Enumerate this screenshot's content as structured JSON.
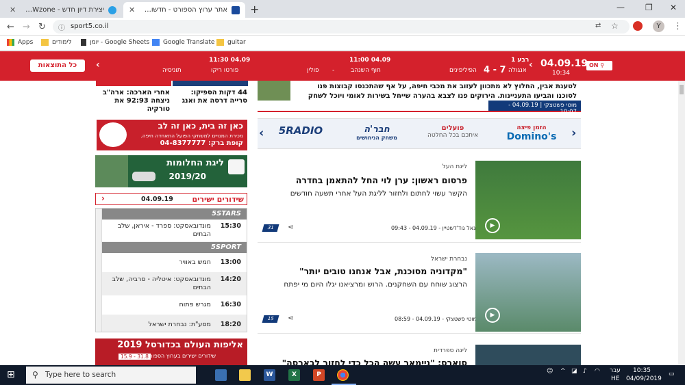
{
  "browser": {
    "tabs": [
      {
        "title": "יצירת דיון חדש - HWzone פורומים"
      },
      {
        "title": "אתר ערוץ הספורט - חדשות הספורט"
      }
    ],
    "new_tab": "+",
    "url": "sport5.co.il",
    "avatar_letter": "Y"
  },
  "bookmarks": [
    {
      "label": "Apps"
    },
    {
      "label": "לימודים"
    },
    {
      "label": "יומן - Google Sheets"
    },
    {
      "label": "Google Translate"
    },
    {
      "label": "guitar"
    }
  ],
  "scoreboard": {
    "results_button": "כל התוצאות",
    "date": "04.09.19",
    "clock": "10:34",
    "toggle": "ON",
    "games": [
      {
        "time": "רבע 1",
        "home": "אנגולה",
        "away": "הפיליפינים",
        "score": "7 - 4"
      },
      {
        "time": "04.09 11:00",
        "home": "חוף השנהב",
        "away": "פולין",
        "score": "-"
      },
      {
        "time": "04.09 11:30",
        "home": "פורטו ריקו",
        "away": "תוניסיה",
        "score": "-"
      }
    ]
  },
  "sidebar": {
    "news": [
      {
        "title": "44 דקות הספיקו: סרייה דרסה את ואנג"
      },
      {
        "title": "אחרי הארכה: ארה\"ב ניצחה 92:93 את טורקיה"
      }
    ],
    "ad_hapoel": {
      "headline": "כאן זה בית, כאן זה לב",
      "sub": "מכירת המנויים למשחקי הפועל התאחדה חיפה.",
      "phone": "קופת ברק: 04-8377777"
    },
    "ad_league": {
      "title": "ליגת החלומות",
      "season": "2019/20"
    },
    "live": {
      "title": "שידורים ישירים",
      "date": "04.09.19",
      "channels": [
        {
          "name": "5STARS",
          "rows": [
            {
              "time": "15:30",
              "name": "מונדובאסקט: ספרד - איראן, שלב הבתים"
            }
          ]
        },
        {
          "name": "5SPORT",
          "rows": [
            {
              "time": "13:00",
              "name": "חמש באוויר"
            },
            {
              "time": "14:20",
              "name": "מונדובאסקט: איטליה - סרביה, שלב הבתים"
            },
            {
              "time": "16:30",
              "name": "מגרש פתוח"
            },
            {
              "time": "18:20",
              "name": "מסע\"ת: נבחרת ישראל"
            }
          ]
        }
      ]
    },
    "ad_worldcup": {
      "title": "אליפות העולם בכדורסל 2019",
      "sub": "שידורים ישירים בערוץ הספורט",
      "dates": "31.8 - 15.9"
    }
  },
  "top_story": {
    "text": "לטענת אבין, החלוץ לא מתכוון לעזוב את מכבי חיפה, על אף שהתכנסו קבוצות פנו לסוכנו והביעו התעניינות. הירוקים פנו לצבא בהערה שייחל בשירות לאומי ויוכל לשחק בנבחרת",
    "meta": "מוטי פשטצקי | 04.09.19 - 10:07"
  },
  "sponsors": [
    {
      "name": "Domino's",
      "sub": "הזמן פיצה"
    },
    {
      "name": "פועלים",
      "sub": "איתכם בכל החלטה"
    },
    {
      "name": "חבר'ה",
      "sub": "משחק הניחושים"
    },
    {
      "name": "5RADIO",
      "sub": ""
    }
  ],
  "articles": [
    {
      "category": "ליגת העל",
      "headline": "פרסום ראשון: ערן לוי החל להתאמן בחדרה",
      "sub": "הקשר עשוי לחתום ולחזור לליגת העל אחרי תשעה חודשים",
      "meta": "יגאל גוד'דשטיין - 04.09.19 - 09:43",
      "comments": "31"
    },
    {
      "category": "נבחרת ישראל",
      "headline": "\"מקדוניה מסוכנת, אבל אנחנו טובים יותר\"",
      "sub": "הרצוג שוחח עם השחקנים. הרוש ומרציאנו יגלו היום מי יפתח",
      "meta": "מוטי פשטצקי - 04.09.19 - 08:59",
      "comments": "15"
    },
    {
      "category": "ליגה ספרדית",
      "headline": "סוארס: \"ניימאר עשה הכל כדי לחזור לבארסה\"",
      "sub": "",
      "meta": "",
      "comments": ""
    }
  ],
  "taskbar": {
    "search_placeholder": "Type here to search",
    "lang": "HE",
    "lang_label": "עבר",
    "time": "10:35",
    "date": "04/09/2019"
  }
}
